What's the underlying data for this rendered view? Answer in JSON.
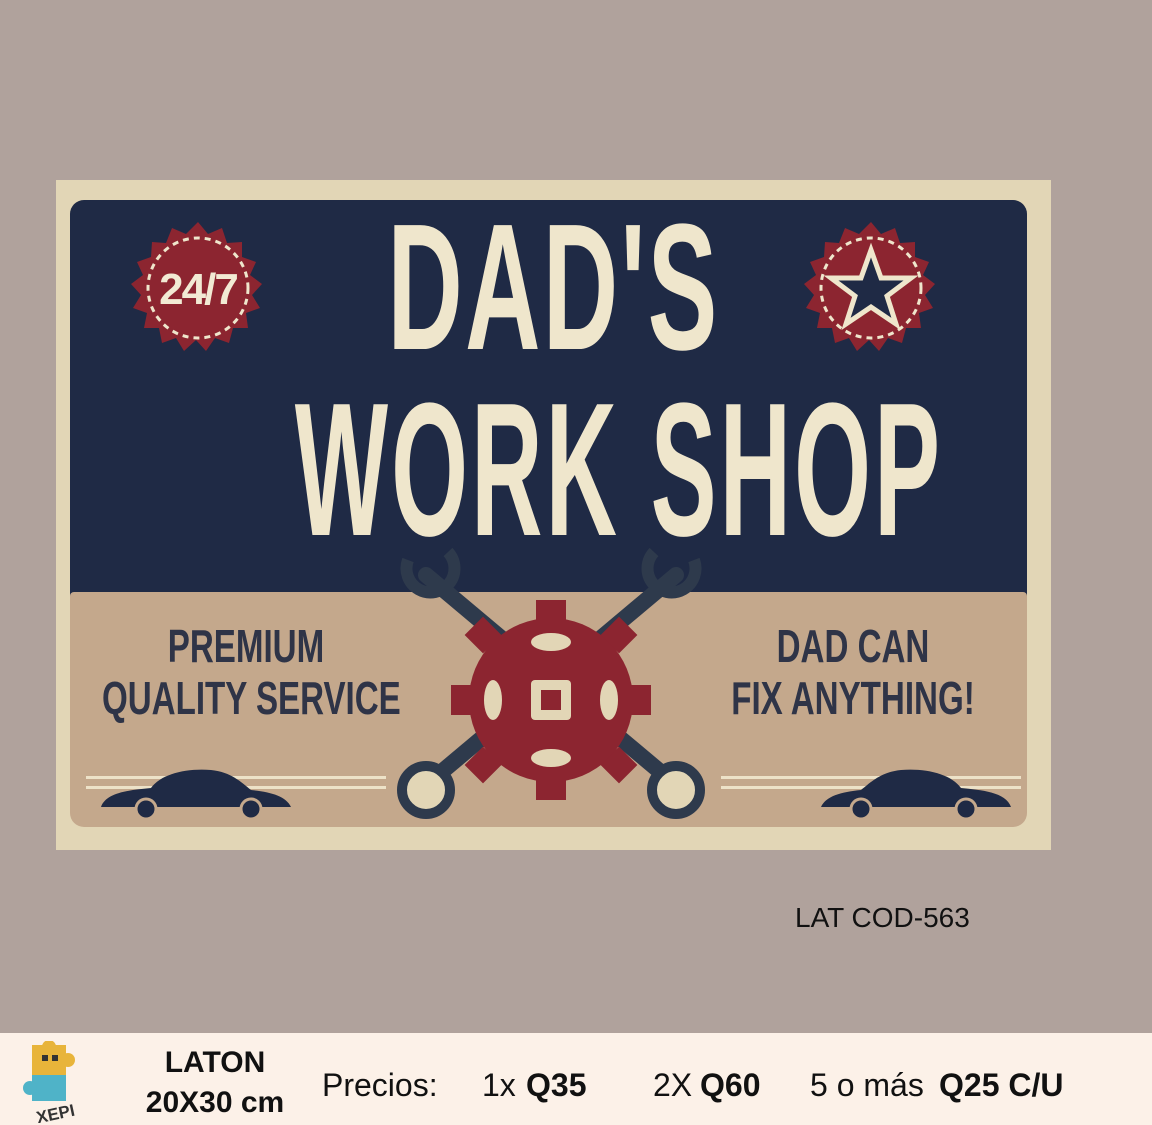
{
  "sign": {
    "badge_left": "24/7",
    "title_line1": "DAD'S",
    "title_line2": "WORK SHOP",
    "slogan_left_line1": "PREMIUM",
    "slogan_left_line2": "QUALITY SERVICE",
    "slogan_right_line1": "DAD CAN",
    "slogan_right_line2": "FIX ANYTHING!",
    "badge_right_icon": "star-icon",
    "emblem_icon": "gear-wrench-icon",
    "car_icon": "car-icon",
    "colors": {
      "navy": "#1f2a45",
      "cream": "#efe6cc",
      "tan": "#c4a88c",
      "red": "#8c2530"
    }
  },
  "product_code": "LAT COD-563",
  "footer": {
    "logo_text": "XEPI",
    "material": "LATON",
    "size": "20X30 cm",
    "prices_label": "Precios:",
    "price1_qty": "1x",
    "price1_value": "Q35",
    "price2_qty": "2X",
    "price2_value": "Q60",
    "price3_qty": "5 o más",
    "price3_value": "Q25 C/U"
  }
}
